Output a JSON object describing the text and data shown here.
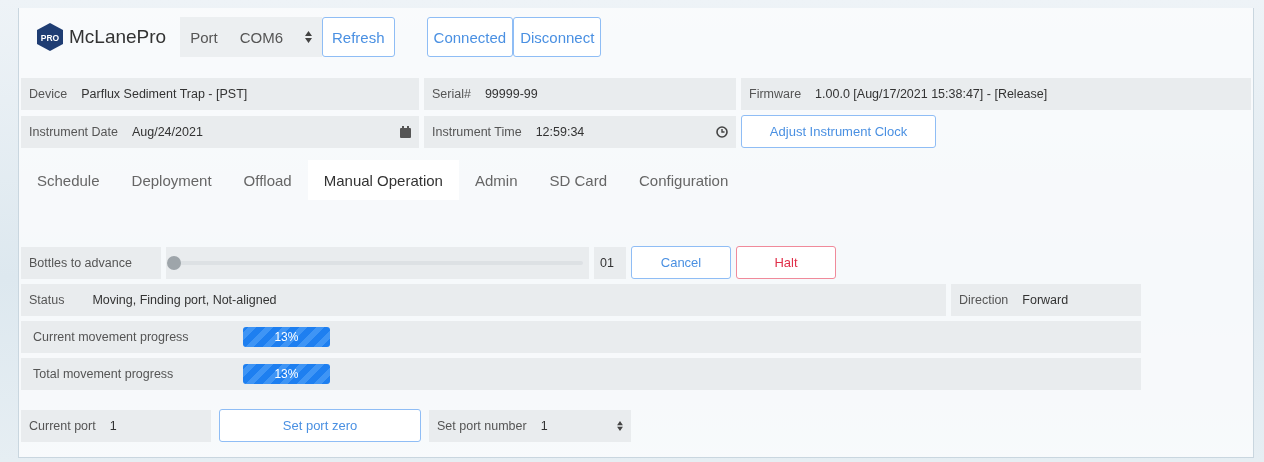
{
  "header": {
    "logo_badge": "PRO",
    "app_name": "McLanePro",
    "port": {
      "label": "Port",
      "value": "COM6"
    },
    "refresh_button": "Refresh",
    "connection_buttons": [
      "Connected",
      "Disconnect"
    ]
  },
  "info": {
    "device": {
      "label": "Device",
      "value": "Parflux Sediment Trap - [PST]"
    },
    "serial": {
      "label": "Serial#",
      "value": "99999-99"
    },
    "firmware": {
      "label": "Firmware",
      "value": "1.00.0 [Aug/17/2021 15:38:47] - [Release]"
    },
    "instrument_date": {
      "label": "Instrument Date",
      "value": "Aug/24/2021"
    },
    "instrument_time": {
      "label": "Instrument Time",
      "value": "12:59:34"
    },
    "adjust_button": "Adjust Instrument Clock"
  },
  "tabs": [
    {
      "label": "Schedule",
      "selected": false
    },
    {
      "label": "Deployment",
      "selected": false
    },
    {
      "label": "Offload",
      "selected": false
    },
    {
      "label": "Manual Operation",
      "selected": true
    },
    {
      "label": "Admin",
      "selected": false
    },
    {
      "label": "SD Card",
      "selected": false
    },
    {
      "label": "Configuration",
      "selected": false
    }
  ],
  "manual": {
    "bottles": {
      "label": "Bottles to advance",
      "level": 0,
      "value": "01"
    },
    "cancel_button": "Cancel",
    "halt_button": "Halt",
    "status": {
      "label": "Status",
      "value": "Moving, Finding port, Not-aligned"
    },
    "direction": {
      "label": "Direction",
      "value": "Forward"
    },
    "progress": [
      {
        "label": "Current movement progress",
        "level": 0.13,
        "reading": "13%"
      },
      {
        "label": "Total movement progress",
        "level": 0.13,
        "reading": "13%"
      }
    ],
    "current_port": {
      "label": "Current port",
      "value": "1"
    },
    "set_port_zero_button": "Set port zero",
    "set_port_number": {
      "label": "Set port number",
      "value": "1"
    }
  }
}
